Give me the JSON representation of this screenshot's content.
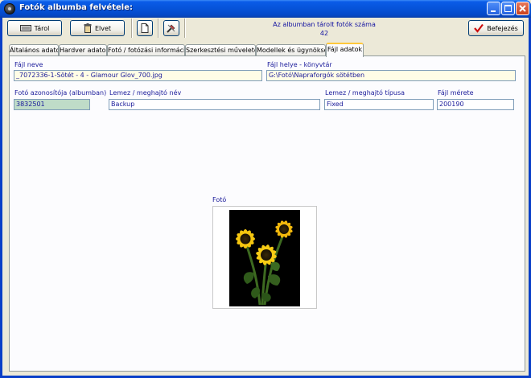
{
  "window": {
    "title": "Fotók albumba felvétele:",
    "controls": {
      "minimize": "minimize-icon",
      "maximize": "maximize-icon",
      "close": "close-icon"
    }
  },
  "toolbar": {
    "save_label": "Tárol",
    "discard_label": "Elvet",
    "counter_label": "Az albumban tárolt fotók száma",
    "counter_value": "42",
    "finish_label": "Befejezés"
  },
  "tabs": [
    {
      "label": "Általános adatok"
    },
    {
      "label": "Hardver adatok"
    },
    {
      "label": "Fotó / fotózási információk"
    },
    {
      "label": "Szerkesztési műveletek"
    },
    {
      "label": "Modellek és ügynökség"
    },
    {
      "label": "Fájl adatok",
      "active": true
    }
  ],
  "file": {
    "name_label": "Fájl neve",
    "name_value": "_7072336-1-Sötét - 4 - Glamour Glov_700.jpg",
    "path_label": "Fájl helye - könyvtár",
    "path_value": "G:\\Fotó\\Napraforgók sötétben",
    "id_label": "Fotó azonosítója (albumban)",
    "id_value": "3832501",
    "volume_label": "Lemez / meghajtó név",
    "volume_value": "Backup",
    "type_label": "Lemez / meghajtó típusa",
    "type_value": "Fixed",
    "size_label": "Fájl mérete",
    "size_value": "200190"
  },
  "photo": {
    "label": "Fotó"
  },
  "colors": {
    "title_bar": "#0653D8",
    "label_text": "#1a1a9a",
    "readonly_field": "#FFFDE6",
    "id_field": "#BFDCC8",
    "active_tab_accent": "#FFC83C"
  }
}
